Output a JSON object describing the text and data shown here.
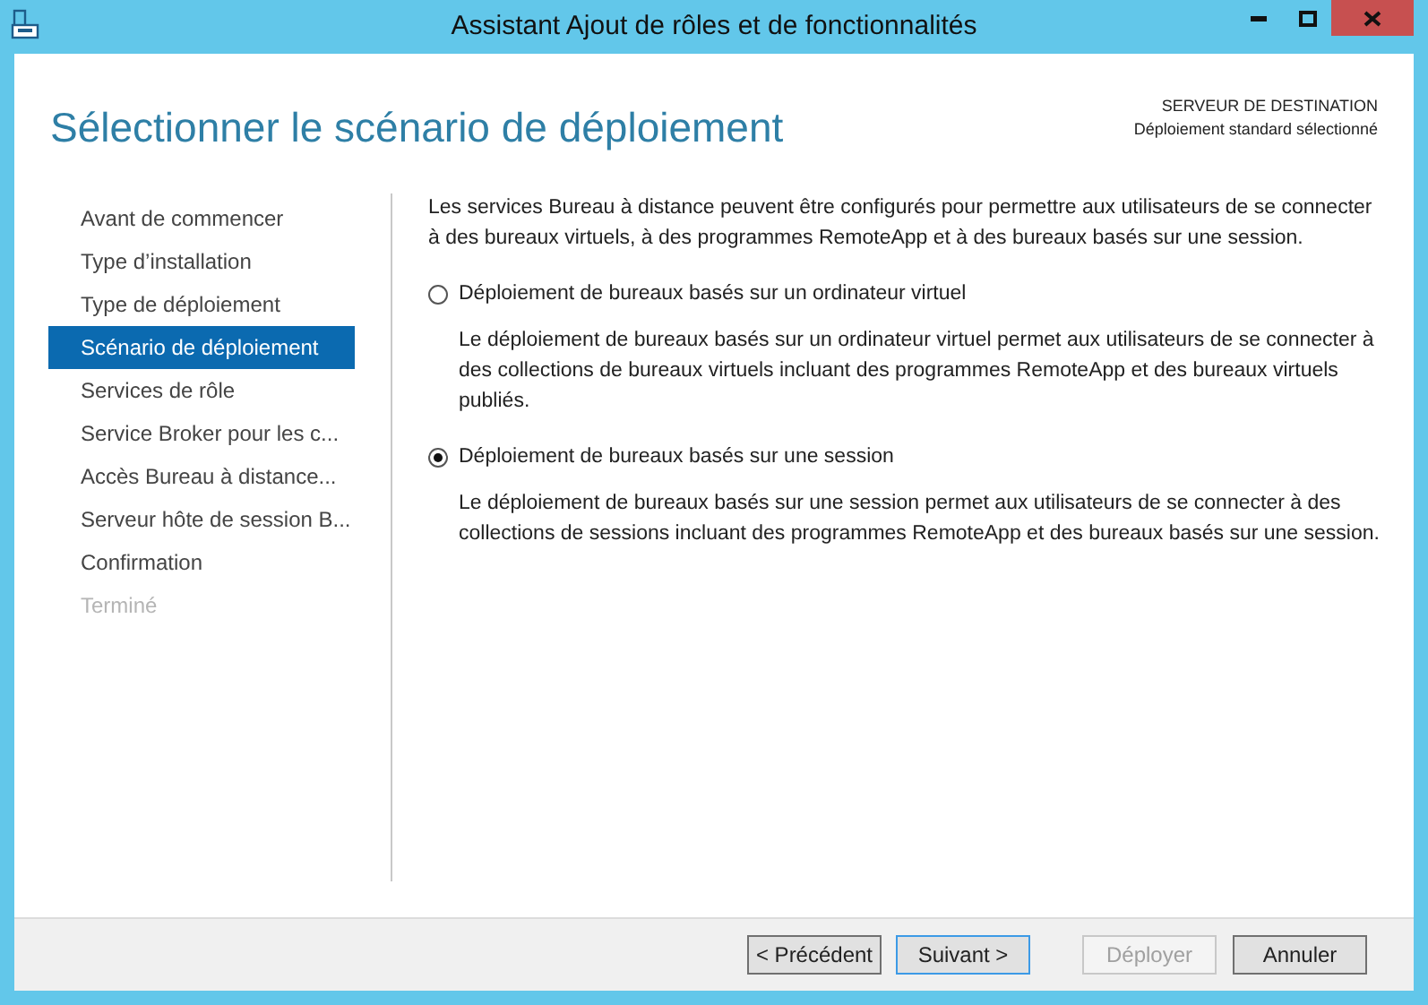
{
  "window": {
    "title": "Assistant Ajout de rôles et de fonctionnalités"
  },
  "header": {
    "title": "Sélectionner le scénario de déploiement",
    "destination_label": "SERVEUR DE DESTINATION",
    "destination_value": "Déploiement standard sélectionné"
  },
  "steps": [
    {
      "label": "Avant de commencer",
      "selected": false,
      "disabled": false
    },
    {
      "label": "Type d’installation",
      "selected": false,
      "disabled": false
    },
    {
      "label": "Type de déploiement",
      "selected": false,
      "disabled": false
    },
    {
      "label": "Scénario de déploiement",
      "selected": true,
      "disabled": false
    },
    {
      "label": "Services de rôle",
      "selected": false,
      "disabled": false
    },
    {
      "label": "Service Broker pour les c...",
      "selected": false,
      "disabled": false
    },
    {
      "label": "Accès Bureau à distance...",
      "selected": false,
      "disabled": false
    },
    {
      "label": "Serveur hôte de session B...",
      "selected": false,
      "disabled": false
    },
    {
      "label": "Confirmation",
      "selected": false,
      "disabled": false
    },
    {
      "label": "Terminé",
      "selected": false,
      "disabled": true
    }
  ],
  "intro": "Les services Bureau à distance peuvent être configurés pour permettre aux utilisateurs de se connecter à des bureaux virtuels, à des programmes RemoteApp et à des bureaux basés sur une session.",
  "options": [
    {
      "label": "Déploiement de bureaux basés sur un ordinateur virtuel",
      "selected": false,
      "description": "Le déploiement de bureaux basés sur un ordinateur virtuel permet aux utilisateurs de se connecter à des collections de bureaux virtuels incluant des programmes RemoteApp et des bureaux virtuels publiés."
    },
    {
      "label": "Déploiement de bureaux basés sur une session",
      "selected": true,
      "description": "Le déploiement de bureaux basés sur une session permet aux utilisateurs de se connecter à des collections de sessions incluant des programmes RemoteApp et des bureaux basés sur une session."
    }
  ],
  "buttons": [
    {
      "label": "< Précédent",
      "disabled": false,
      "default": false
    },
    {
      "label": "Suivant >",
      "disabled": false,
      "default": true
    },
    {
      "label": "Déployer",
      "disabled": true,
      "default": false
    },
    {
      "label": "Annuler",
      "disabled": false,
      "default": false
    }
  ]
}
